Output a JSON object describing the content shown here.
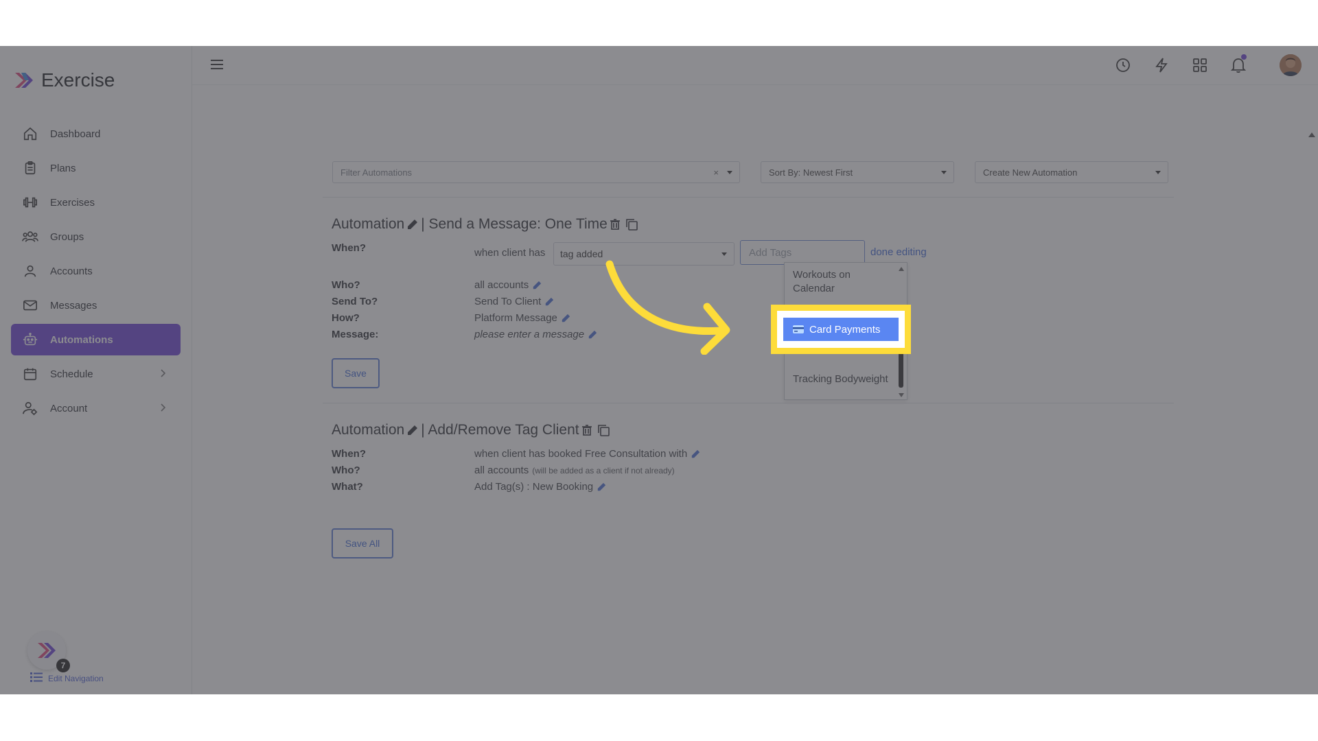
{
  "brand": {
    "name": "Exercise"
  },
  "sidebar": {
    "items": [
      {
        "label": "Dashboard",
        "icon": "home-icon"
      },
      {
        "label": "Plans",
        "icon": "clipboard-icon"
      },
      {
        "label": "Exercises",
        "icon": "dumbbell-icon"
      },
      {
        "label": "Groups",
        "icon": "users-icon"
      },
      {
        "label": "Accounts",
        "icon": "user-icon"
      },
      {
        "label": "Messages",
        "icon": "mail-icon"
      },
      {
        "label": "Automations",
        "icon": "robot-icon",
        "active": true
      },
      {
        "label": "Schedule",
        "icon": "calendar-icon",
        "expandable": true
      },
      {
        "label": "Account",
        "icon": "user-gear-icon",
        "expandable": true
      }
    ],
    "edit_nav_label": "Edit Navigation",
    "edit_nav_badge": "7"
  },
  "toolbar": {
    "filter_placeholder": "Filter Automations",
    "clear_symbol": "×",
    "sort_label": "Sort By: Newest First",
    "create_label": "Create New Automation"
  },
  "automation1": {
    "title_prefix": "Automation",
    "title_suffix": "| Send a Message: One Time",
    "when_label": "When?",
    "when_text": "when client has",
    "when_select": "tag added",
    "tag_placeholder": "Add Tags",
    "done_label": "done editing",
    "who_label": "Who?",
    "who_value": "all accounts",
    "sendto_label": "Send To?",
    "sendto_value": "Send To Client",
    "how_label": "How?",
    "how_value": "Platform Message",
    "message_label": "Message:",
    "message_value": "please enter a message",
    "save_label": "Save"
  },
  "tag_dropdown": {
    "items": [
      "Workouts on Calendar",
      "Card Payments",
      "Tracking Bodyweight"
    ],
    "highlighted": "Card Payments"
  },
  "automation2": {
    "title_prefix": "Automation",
    "title_suffix": "| Add/Remove Tag Client",
    "when_label": "When?",
    "when_value": "when client has booked Free Consultation with",
    "who_label": "Who?",
    "who_value": "all accounts",
    "who_note": "(will be added as a client if not already)",
    "what_label": "What?",
    "what_value": "Add Tag(s) : New Booking"
  },
  "save_all_label": "Save All",
  "colors": {
    "accent": "#6d42d8",
    "link": "#3f6ad8",
    "highlight": "#fddc3a",
    "selected": "#5a86f2"
  }
}
